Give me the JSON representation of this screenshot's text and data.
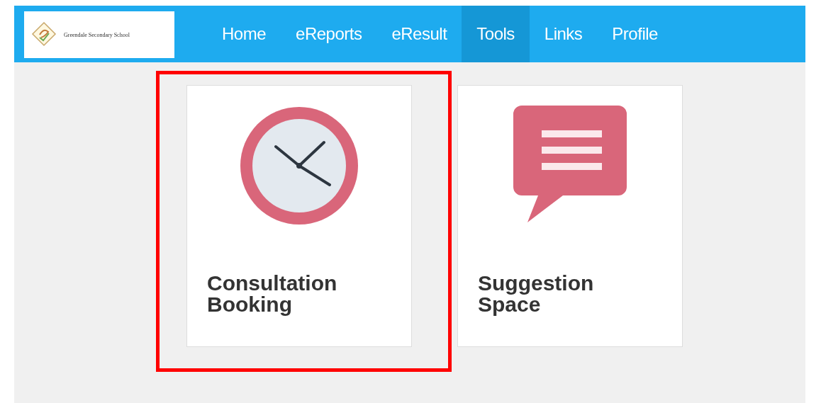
{
  "header": {
    "school_name": "Greendale Secondary School"
  },
  "nav": [
    {
      "label": "Home",
      "selected": false
    },
    {
      "label": "eReports",
      "selected": false
    },
    {
      "label": "eResult",
      "selected": false
    },
    {
      "label": "Tools",
      "selected": true
    },
    {
      "label": "Links",
      "selected": false
    },
    {
      "label": "Profile",
      "selected": false
    }
  ],
  "tiles": [
    {
      "kind": "clock",
      "title": "Consultation Booking",
      "highlighted": true
    },
    {
      "kind": "chat",
      "title": "Suggestion Space",
      "highlighted": false
    }
  ]
}
